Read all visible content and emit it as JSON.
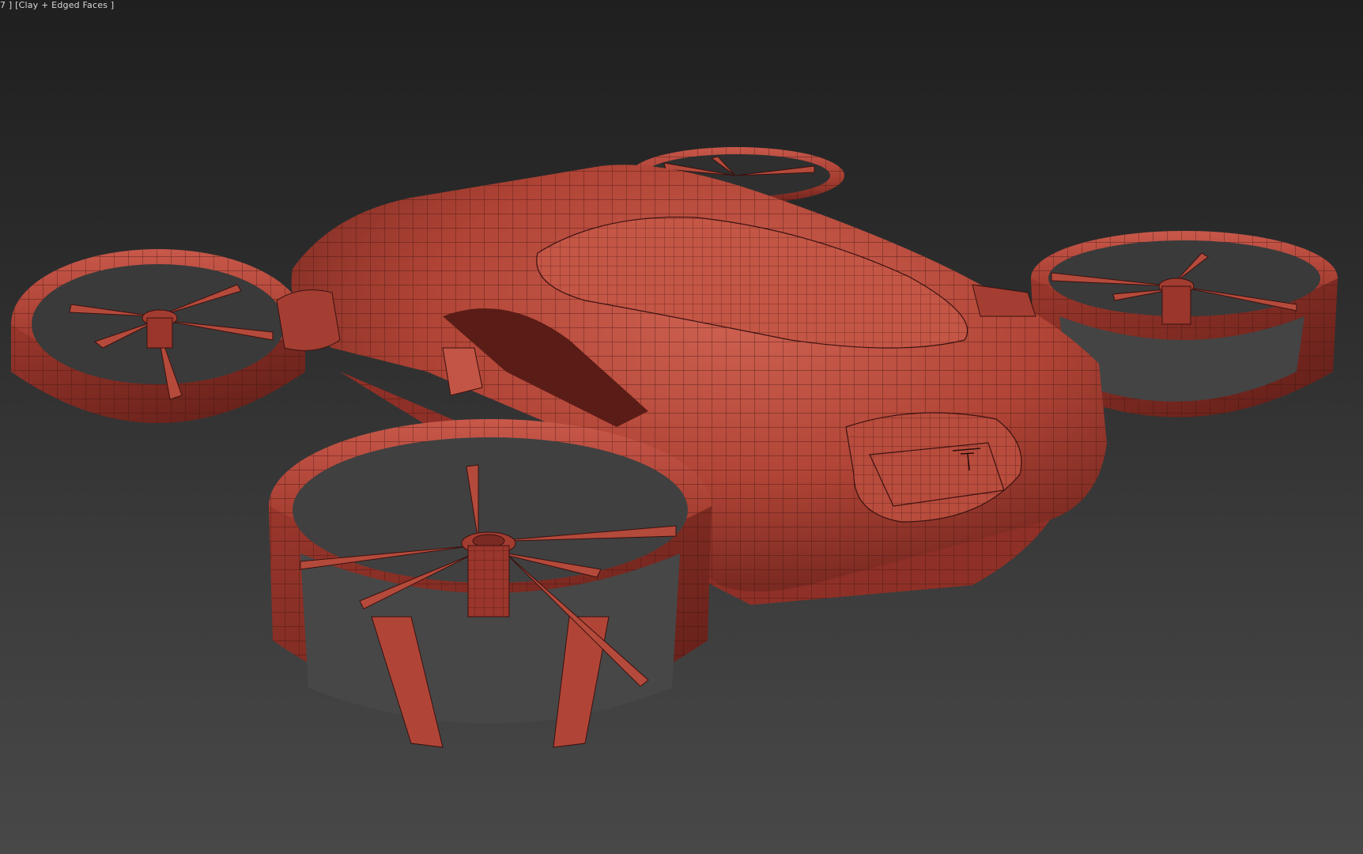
{
  "viewport": {
    "label_index": "7 ]",
    "label_mode": "[Clay + Edged Faces ]"
  },
  "colors": {
    "background_top": "#1f1f1f",
    "background_bottom": "#484848",
    "clay": "#b24638",
    "clay_dark": "#7a2a22",
    "clay_light": "#c95a4a",
    "edge": "#3a1210"
  },
  "scene": {
    "object_icon": "drone-quadcopter-icon"
  }
}
